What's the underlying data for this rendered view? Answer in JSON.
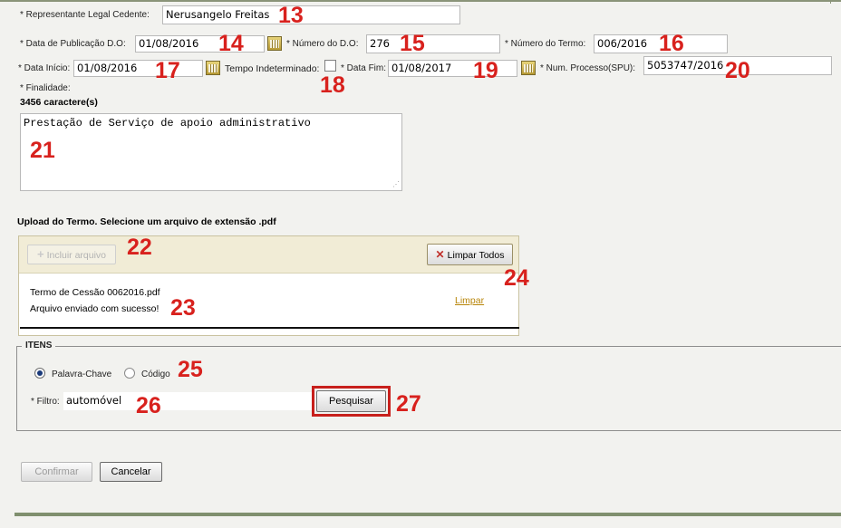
{
  "form": {
    "representante_label": "* Representante Legal Cedente:",
    "representante_value": "Nerusangelo Freitas",
    "data_pub_label": "* Data de Publicação D.O:",
    "data_pub_value": "01/08/2016",
    "numero_do_label": "* Número do D.O:",
    "numero_do_value": "276",
    "numero_termo_label": "* Número do Termo:",
    "numero_termo_value": "006/2016",
    "data_inicio_label": "* Data Início:",
    "data_inicio_value": "01/08/2016",
    "tempo_indet_label": "Tempo Indeterminado:",
    "data_fim_label": "* Data Fim:",
    "data_fim_value": "01/08/2017",
    "num_processo_label": "* Num. Processo(SPU):",
    "num_processo_value": "5053747/2016",
    "finalidade_label": "* Finalidade:",
    "char_count": "3456 caractere(s)",
    "finalidade_value": "Prestação de Serviço de apoio administrativo"
  },
  "upload": {
    "title": "Upload do Termo. Selecione um arquivo de extensão .pdf",
    "incluir_label": "Incluir arquivo",
    "limpar_todos_label": "Limpar Todos",
    "file_name": "Termo de Cessão 0062016.pdf",
    "file_status": "Arquivo enviado com sucesso!",
    "limpar_link": "Limpar"
  },
  "itens": {
    "legend": "ITENS",
    "radio_palavra": "Palavra-Chave",
    "radio_codigo": "Código",
    "selected": "Palavra-Chave",
    "filtro_label": "* Filtro:",
    "filtro_value": "automóvel",
    "pesquisar_label": "Pesquisar"
  },
  "actions": {
    "confirmar_label": "Confirmar",
    "cancelar_label": "Cancelar"
  },
  "annotations": {
    "n13": "13",
    "n14": "14",
    "n15": "15",
    "n16": "16",
    "n17": "17",
    "n18": "18",
    "n19": "19",
    "n20": "20",
    "n21": "21",
    "n22": "22",
    "n23": "23",
    "n24": "24",
    "n25": "25",
    "n26": "26",
    "n27": "27"
  },
  "colors": {
    "annotation": "#d8211d",
    "panel_border": "#c9c2a0",
    "bottom_bar": "#7f8f6e",
    "link": "#b8860b"
  }
}
